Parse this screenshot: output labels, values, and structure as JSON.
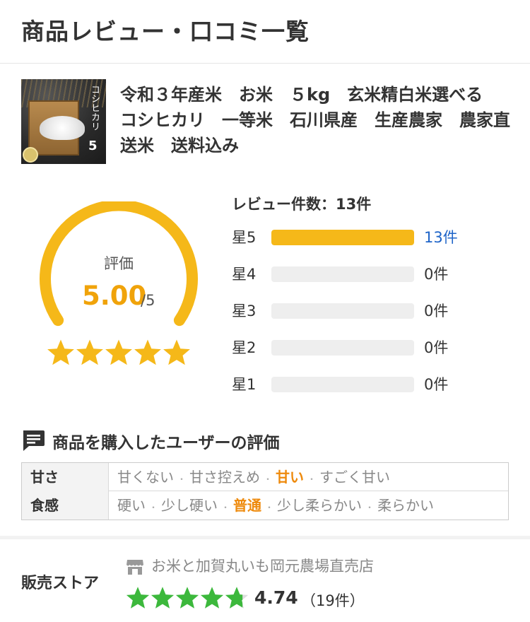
{
  "header": {
    "title": "商品レビュー・口コミ一覧"
  },
  "product": {
    "name": "令和３年産米　お米　５kg　玄米精白米選べる　コシヒカリ　一等米　石川県産　生産農家　農家直送米　送料込み",
    "thumbnail_label": "コシヒカリ",
    "thumbnail_weight": "5"
  },
  "rating": {
    "label": "評価",
    "score": "5.00",
    "max": "/5",
    "stars_filled": 5,
    "star_color": "#f5b819",
    "review_count_title": "レビュー件数：13件",
    "distribution": [
      {
        "label": "星5",
        "count_text": "13件",
        "fraction": 1.0
      },
      {
        "label": "星4",
        "count_text": "0件",
        "fraction": 0
      },
      {
        "label": "星3",
        "count_text": "0件",
        "fraction": 0
      },
      {
        "label": "星2",
        "count_text": "0件",
        "fraction": 0
      },
      {
        "label": "星1",
        "count_text": "0件",
        "fraction": 0
      }
    ]
  },
  "evaluation": {
    "heading": "商品を購入したユーザーの評価",
    "icon": "chat-icon",
    "rows": [
      {
        "key": "甘さ",
        "options": [
          "甘くない",
          "甘さ控えめ",
          "甘い",
          "すごく甘い"
        ],
        "selected": 2
      },
      {
        "key": "食感",
        "options": [
          "硬い",
          "少し硬い",
          "普通",
          "少し柔らかい",
          "柔らかい"
        ],
        "selected": 2
      }
    ]
  },
  "store": {
    "label": "販売ストア",
    "icon": "store-icon",
    "name": "お米と加賀丸いも岡元農場直売店",
    "rating": "4.74",
    "rating_value": 4.74,
    "count": "（19件）",
    "star_color": "#3cb83c"
  }
}
